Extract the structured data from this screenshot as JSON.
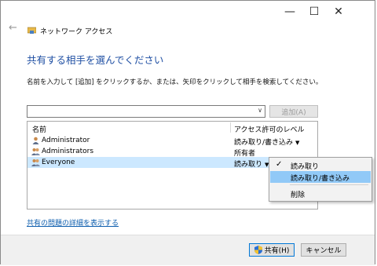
{
  "window": {
    "title": "ネットワーク アクセス",
    "controls": {
      "minimize": "—",
      "maximize": "☐",
      "close": "✕"
    },
    "back_glyph": "←"
  },
  "main": {
    "heading": "共有する相手を選んでください",
    "instruction": "名前を入力して [追加] をクリックするか、または、矢印をクリックして相手を検索してください。",
    "combo": {
      "value": "",
      "arrow": "∨"
    },
    "add_button": "追加(A)"
  },
  "list": {
    "headers": {
      "name": "名前",
      "access": "アクセス許可のレベル"
    },
    "rows": [
      {
        "name": "Administrator",
        "access": "読み取り/書き込み",
        "has_dropdown": true,
        "icon": "user-icon"
      },
      {
        "name": "Administrators",
        "access": "所有者",
        "has_dropdown": false,
        "icon": "group-icon"
      },
      {
        "name": "Everyone",
        "access": "読み取り",
        "has_dropdown": true,
        "icon": "group-icon",
        "selected": true
      }
    ],
    "dropdown_glyph": "▼"
  },
  "menu": {
    "items": [
      {
        "label": "読み取り",
        "checked": true
      },
      {
        "label": "読み取り/書き込み",
        "highlighted": true
      },
      {
        "label": "削除"
      }
    ],
    "check_glyph": "✓"
  },
  "link": "共有の問題の詳細を表示する",
  "footer": {
    "share_button": "共有(H)",
    "cancel_button": "キャンセル"
  },
  "colors": {
    "heading": "#1f4fa3",
    "selection": "#cce8ff",
    "menu_highlight": "#91c9f7",
    "link": "#0b5cad"
  }
}
